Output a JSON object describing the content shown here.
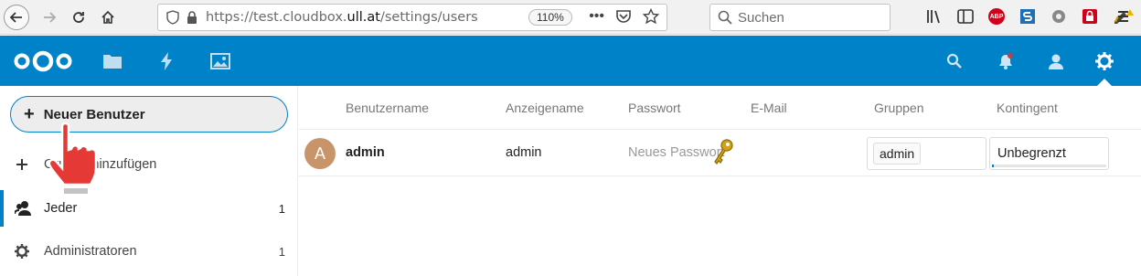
{
  "browser": {
    "url_prefix": "https://test.cloudbox.",
    "url_domain": "ull.at",
    "url_path": "/settings/users",
    "zoom": "110%",
    "search_placeholder": "Suchen"
  },
  "sidebar": {
    "new_user_label": "Neuer Benutzer",
    "add_group_label": "Gruppe hinzufügen",
    "items": [
      {
        "label": "Jeder",
        "count": "1"
      },
      {
        "label": "Administratoren",
        "count": "1"
      }
    ]
  },
  "table": {
    "headers": [
      "Benutzername",
      "Anzeigename",
      "Passwort",
      "E-Mail",
      "Gruppen",
      "Kontingent"
    ],
    "rows": [
      {
        "avatar_letter": "A",
        "username": "admin",
        "display_name": "admin",
        "password_placeholder": "Neues Passwort",
        "group": "admin",
        "quota": "Unbegrenzt"
      }
    ]
  },
  "colors": {
    "brand": "#0082c9",
    "avatar": "#c8956a"
  }
}
